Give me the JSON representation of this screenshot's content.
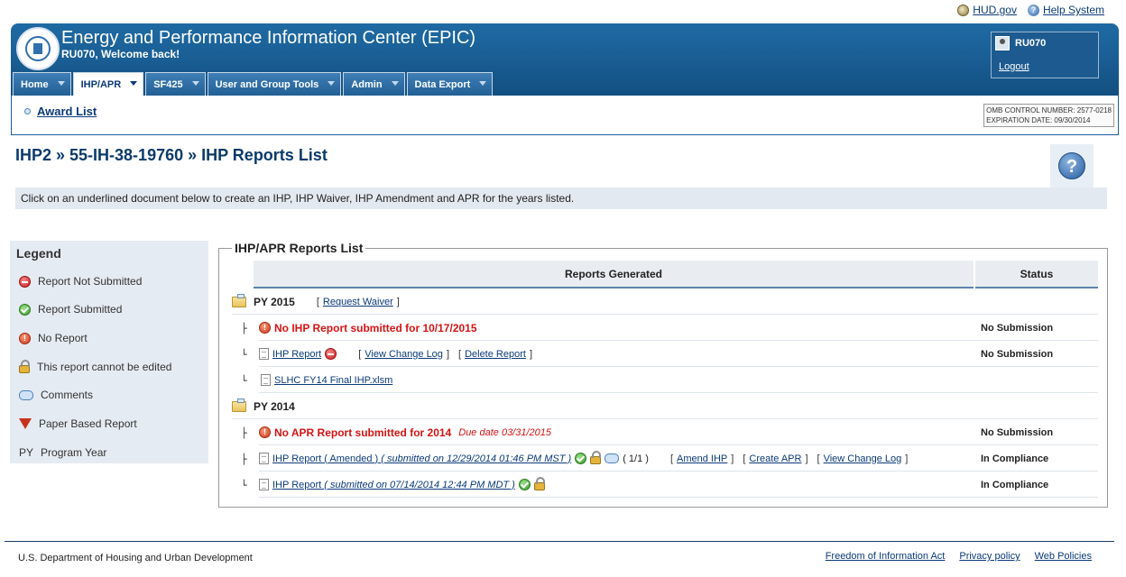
{
  "util": {
    "hud": "HUD.gov",
    "help": "Help System"
  },
  "header": {
    "title": "Energy and Performance Information Center (EPIC)",
    "welcome": "RU070, Welcome back!",
    "user": "RU070",
    "logout": "Logout",
    "nav": [
      "Home",
      "IHP/APR",
      "SF425",
      "User and Group Tools",
      "Admin",
      "Data Export"
    ]
  },
  "subbar": {
    "award_list": "Award List",
    "omb_line1": "OMB CONTROL NUMBER: 2577-0218",
    "omb_line2": "EXPIRATION DATE: 09/30/2014"
  },
  "page": {
    "title": "IHP2 » 55-IH-38-19760 » IHP Reports List",
    "instructions": "Click on an underlined document below to create an IHP, IHP Waiver, IHP Amendment and APR for the years listed."
  },
  "legend": {
    "title": "Legend",
    "items": [
      "Report Not Submitted",
      "Report Submitted",
      "No Report",
      "This report cannot be edited",
      "Comments",
      "Paper Based Report",
      "Program Year"
    ],
    "py_abbr": "PY"
  },
  "reports": {
    "title": "IHP/APR Reports List",
    "col_reports": "Reports Generated",
    "col_status": "Status",
    "py2015": {
      "label": "PY 2015",
      "request_waiver": "Request Waiver",
      "no_ihp": "No IHP Report submitted for 10/17/2015",
      "no_ihp_status": "No Submission",
      "ihp_report": "IHP Report",
      "view_change_log": "View Change Log",
      "delete_report": "Delete Report",
      "ihp_status": "No Submission",
      "file": "SLHC FY14 Final IHP.xlsm"
    },
    "py2014": {
      "label": "PY 2014",
      "no_apr": "No APR Report submitted for 2014",
      "due": "Due date 03/31/2015",
      "no_apr_status": "No Submission",
      "amended_link": "IHP Report ( Amended )",
      "amended_submitted": "( submitted on 12/29/2014 01:46 PM MST )",
      "comment_count": "( 1/1 )",
      "amend_ihp": "Amend IHP",
      "create_apr": "Create APR",
      "view_change_log": "View Change Log",
      "amended_status": "In Compliance",
      "ihp_link": "IHP Report",
      "ihp_submitted": "( submitted on 07/14/2014 12:44 PM MDT )",
      "ihp_status": "In Compliance"
    }
  },
  "footer": {
    "agency": "U.S. Department of Housing and Urban Development",
    "foia": "Freedom of Information Act",
    "privacy": "Privacy policy",
    "web": "Web Policies"
  }
}
